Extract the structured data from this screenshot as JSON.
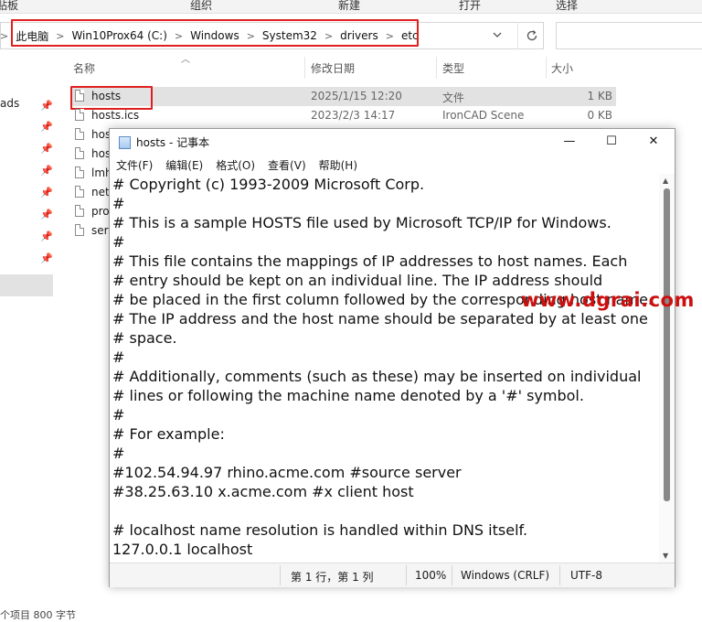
{
  "ribbon": {
    "clipboard_label": "贴板",
    "organize_label": "组织",
    "new_label": "新建",
    "open_label": "打开",
    "select_label": "选择"
  },
  "address_bar": {
    "crumbs": [
      "此电脑",
      "Win10Prox64 (C:)",
      "Windows",
      "System32",
      "drivers",
      "etc"
    ]
  },
  "file_list": {
    "columns": {
      "name": "名称",
      "modified": "修改日期",
      "type": "类型",
      "size": "大小"
    },
    "rows": [
      {
        "name": "hosts",
        "modified": "2025/1/15 12:20",
        "type": "文件",
        "size": "1 KB"
      },
      {
        "name": "hosts.ics",
        "modified": "2023/2/3 14:17",
        "type": "IronCAD Scene",
        "size": "0 KB"
      }
    ],
    "partial_names": [
      "hos",
      "hos",
      "lmh",
      "net",
      "pro",
      "ser"
    ]
  },
  "left_pane": {
    "partial_label": "ads"
  },
  "statusbar_bottom": {
    "text": "个项目  800 字节"
  },
  "notepad": {
    "title": "hosts - 记事本",
    "window_buttons": {
      "minimize": "—",
      "maximize": "☐",
      "close": "✕"
    },
    "menu": [
      "文件(F)",
      "编辑(E)",
      "格式(O)",
      "查看(V)",
      "帮助(H)"
    ],
    "lines": [
      "# Copyright (c) 1993-2009 Microsoft Corp.",
      "#",
      "# This is a sample HOSTS file used by Microsoft TCP/IP for Windows.",
      "#",
      "# This file contains the mappings of IP addresses to host names. Each",
      "# entry should be kept on an individual line. The IP address should",
      "# be placed in the first column followed by the corresponding host name.",
      "# The IP address and the host name should be separated by at least one",
      "# space.",
      "#",
      "# Additionally, comments (such as these) may be inserted on individual",
      "# lines or following the machine name denoted by a '#' symbol.",
      "#",
      "# For example:",
      "#",
      "#102.54.94.97 rhino.acme.com #source server",
      "#38.25.63.10 x.acme.com #x client host",
      "",
      "# localhost name resolution is handled within DNS itself.",
      "127.0.0.1 localhost"
    ],
    "status": {
      "position": "第 1 行，第 1 列",
      "zoom": "100%",
      "line_ending": "Windows (CRLF)",
      "encoding": "UTF-8"
    }
  },
  "watermark": "www.dgrai.com",
  "colors": {
    "highlight_red": "#e02020",
    "watermark_red": "#cc1010"
  }
}
